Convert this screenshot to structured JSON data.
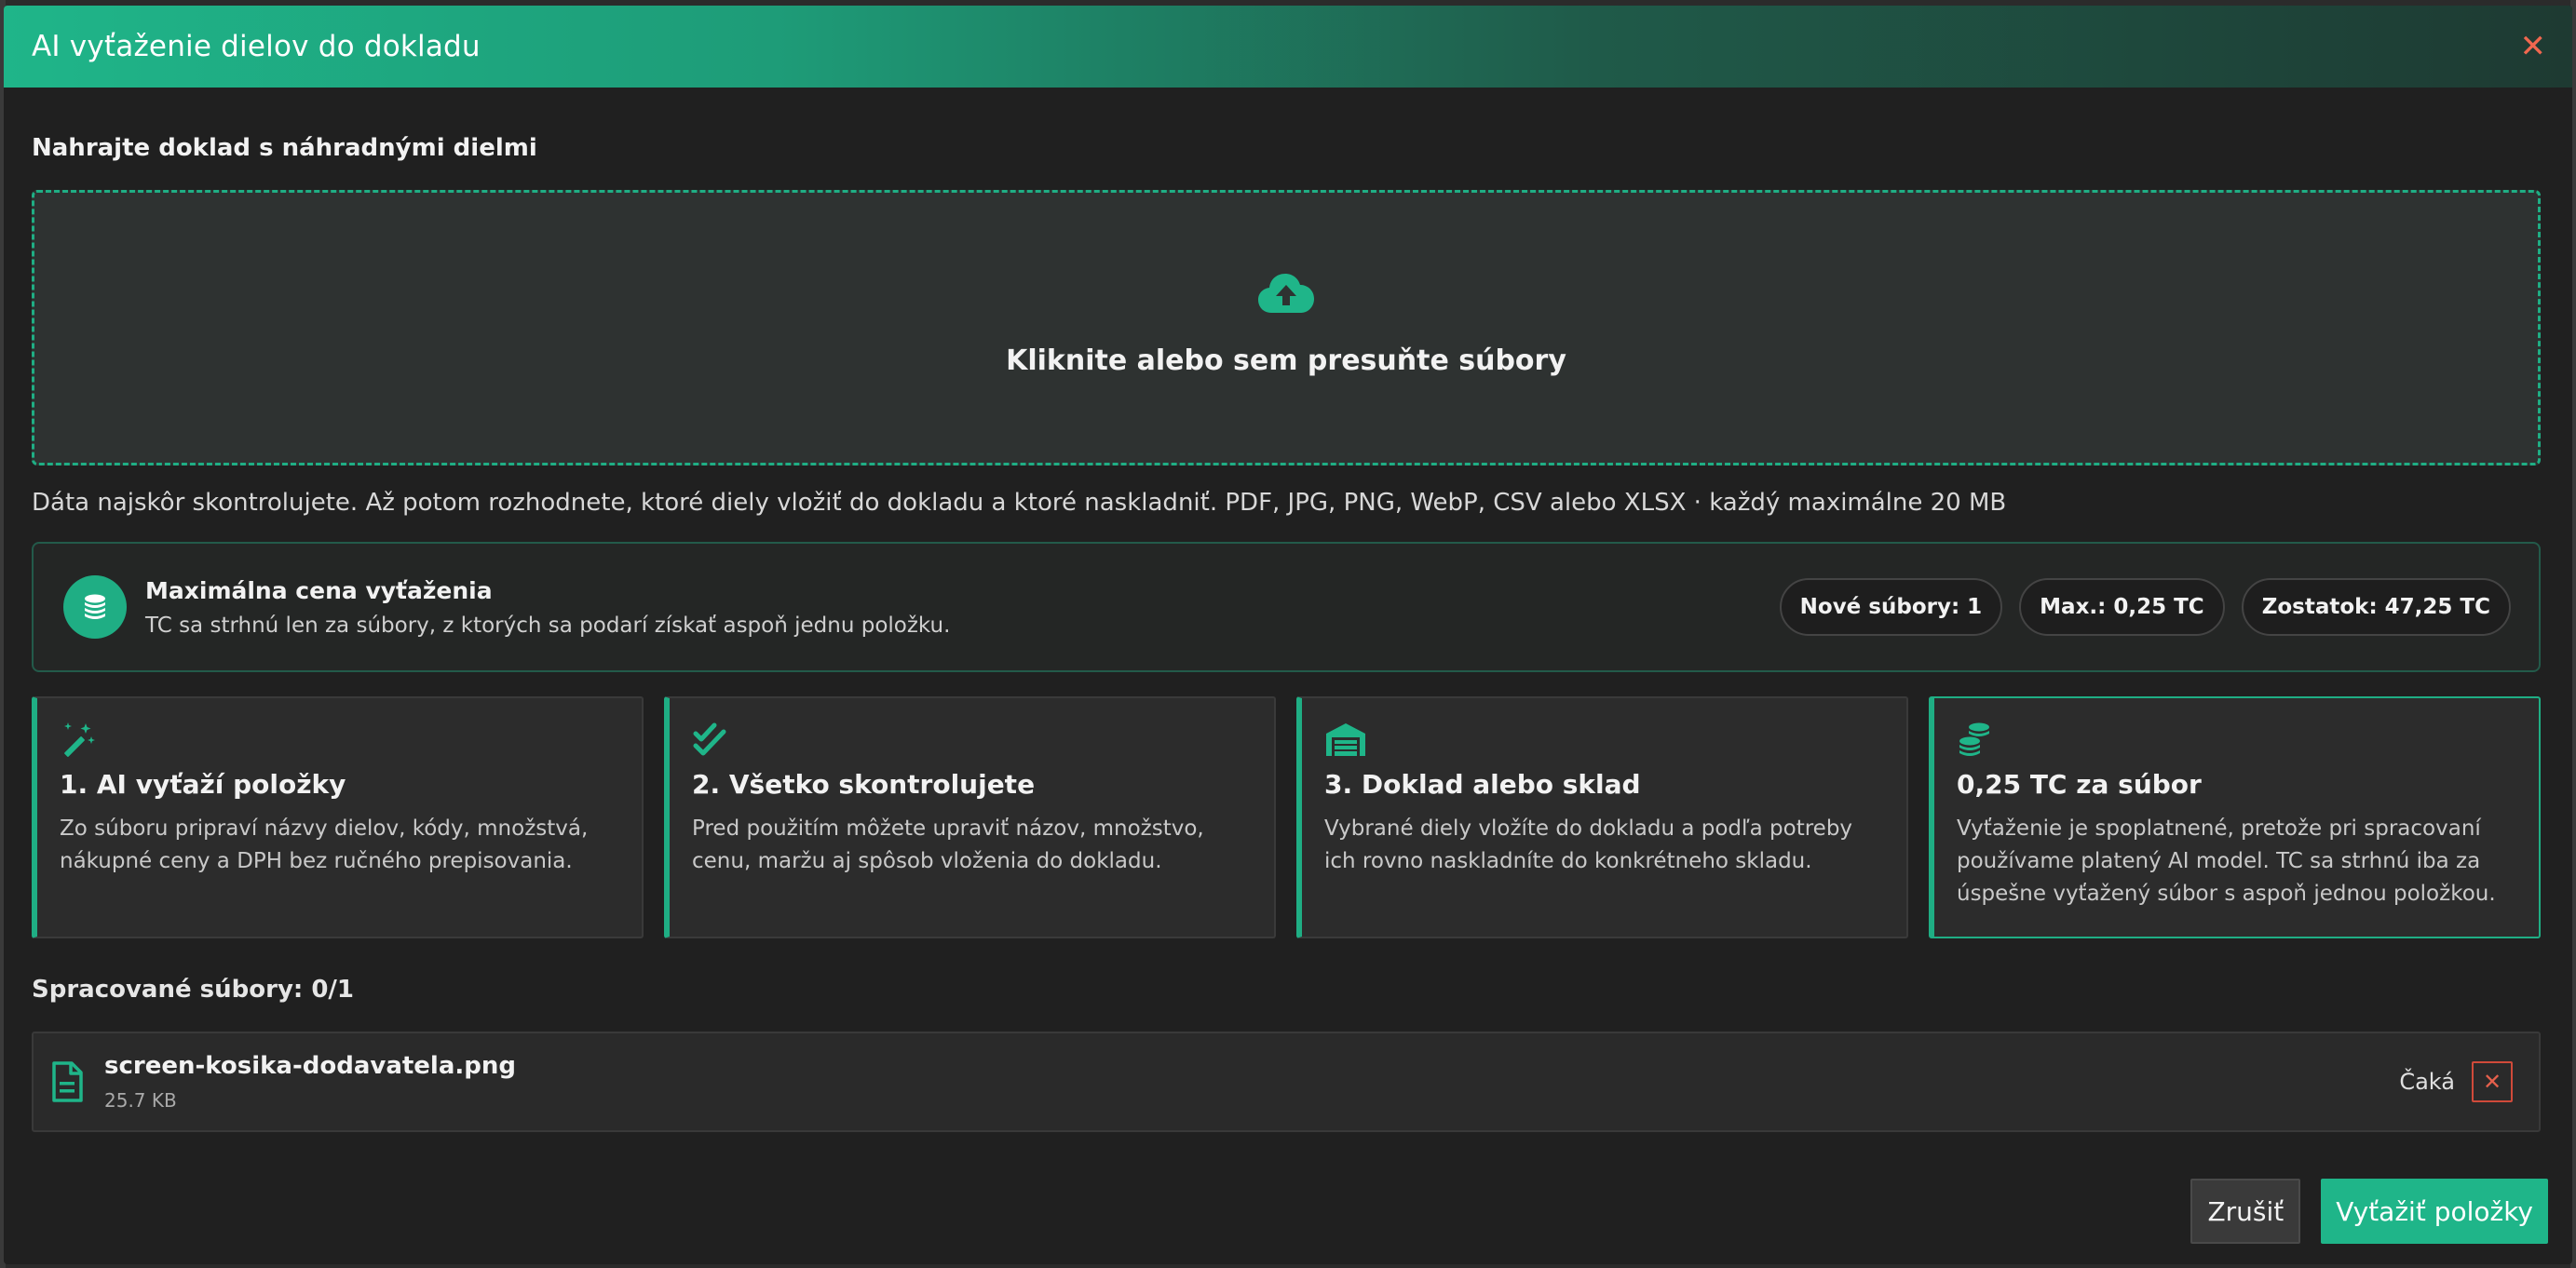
{
  "dialog": {
    "title": "AI vyťaženie dielov do dokladu",
    "close_label": "✕"
  },
  "upload": {
    "heading": "Nahrajte doklad s náhradnými dielmi",
    "dropzone_label": "Kliknite alebo sem presuňte súbory",
    "hint": "Dáta najskôr skontrolujete. Až potom rozhodnete, ktoré diely vložiť do dokladu a ktoré naskladniť. PDF, JPG, PNG, WebP, CSV alebo XLSX · každý maximálne 20 MB"
  },
  "pricing": {
    "title": "Maximálna cena vyťaženia",
    "subtitle": "TC sa strhnú len za súbory, z ktorých sa podarí získať aspoň jednu položku.",
    "new_files": "Nové súbory: 1",
    "max": "Max.: 0,25 TC",
    "balance": "Zostatok: 47,25 TC"
  },
  "steps": [
    {
      "icon": "magic-wand-icon",
      "title": "1. AI vyťaží položky",
      "desc": "Zo súboru pripraví názvy dielov, kódy, množstvá, nákupné ceny a DPH bez ručného prepisovania."
    },
    {
      "icon": "double-check-icon",
      "title": "2. Všetko skontrolujete",
      "desc": "Pred použitím môžete upraviť názov, množstvo, cenu, maržu aj spôsob vloženia do dokladu."
    },
    {
      "icon": "warehouse-icon",
      "title": "3. Doklad alebo sklad",
      "desc": "Vybrané diely vložíte do dokladu a podľa potreby ich rovno naskladníte do konkrétneho skladu."
    },
    {
      "icon": "coins-icon",
      "title": "0,25 TC za súbor",
      "desc": "Vyťaženie je spoplatnené, pretože pri spracovaní používame platený AI model. TC sa strhnú iba za úspešne vyťažený súbor s aspoň jednou položkou."
    }
  ],
  "processed": {
    "label": "Spracované súbory: 0/1",
    "files": [
      {
        "name": "screen-kosika-dodavatela.png",
        "size": "25.7 KB",
        "status": "Čaká",
        "remove_label": "✕"
      }
    ]
  },
  "footer": {
    "cancel_label": "Zrušiť",
    "submit_label": "Vyťažiť položky"
  },
  "colors": {
    "accent": "#1fb589",
    "danger": "#e5604c",
    "background": "#202020"
  }
}
